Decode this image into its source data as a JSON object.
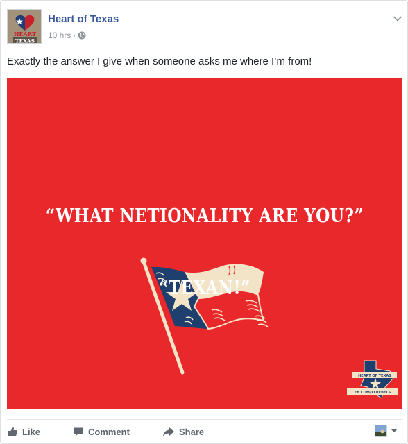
{
  "post": {
    "page_name": "Heart of Texas",
    "timestamp": "10 hrs",
    "separator": "·",
    "message": "Exactly the answer I give when someone asks me where I’m from!"
  },
  "avatar": {
    "line1": "HEART",
    "line2": "TEXAS"
  },
  "image": {
    "question": "“WHAT NETIONALITY ARE YOU?”",
    "answer": "“TEXAN!”",
    "badge_top": "HEART OF TEXAS",
    "badge_bottom": "FB.COM/TXREBELS",
    "background": "#e8282b"
  },
  "actions": {
    "like": "Like",
    "comment": "Comment",
    "share": "Share"
  },
  "icons": {
    "globe": "globe-icon",
    "chevron": "chevron-down-icon",
    "like": "thumbs-up-icon",
    "comment": "comment-icon",
    "share": "share-arrow-icon"
  },
  "colors": {
    "link": "#365899",
    "muted": "#90949c",
    "action": "#606770"
  }
}
